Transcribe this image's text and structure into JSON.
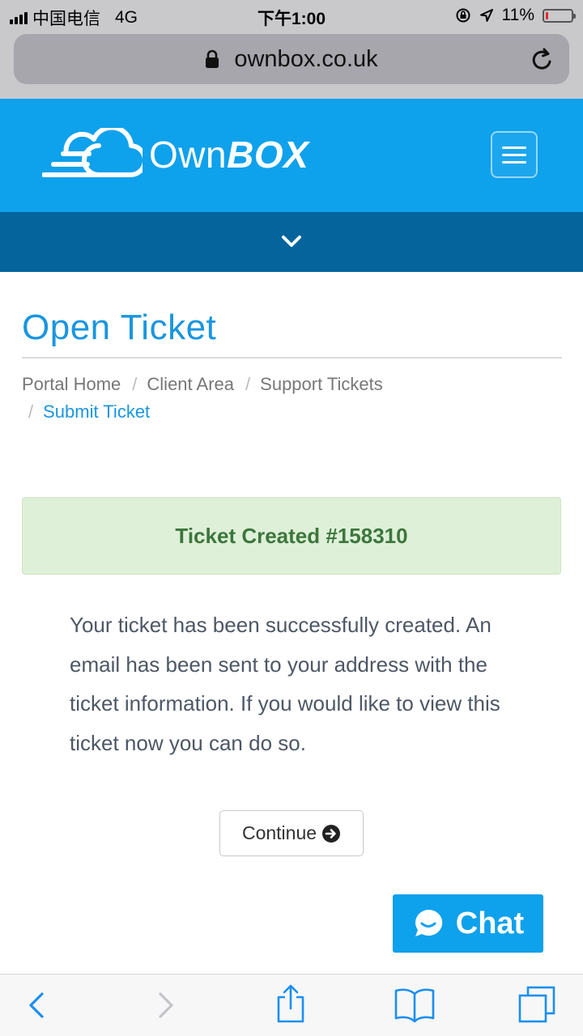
{
  "status_bar": {
    "carrier": "中国电信",
    "network": "4G",
    "time": "下午1:00",
    "battery_text": "11%",
    "battery_level": 0.11,
    "battery_color": "#e32b2b"
  },
  "browser": {
    "url": "ownbox.co.uk",
    "icons": {
      "lock": "lock-icon",
      "reload": "reload-icon"
    }
  },
  "header": {
    "brand_light": "Own",
    "brand_bold": "BOX",
    "background": "#0ea1ec",
    "subnav_background": "#05649c",
    "icons": {
      "logo": "cloud-logo-icon",
      "menu": "hamburger-menu-icon",
      "expand": "chevron-down-icon"
    }
  },
  "page": {
    "title": "Open Ticket",
    "breadcrumb": [
      {
        "label": "Portal Home"
      },
      {
        "label": "Client Area"
      },
      {
        "label": "Support Tickets"
      },
      {
        "label": "Submit Ticket"
      }
    ],
    "breadcrumb_separator": "/"
  },
  "alert": {
    "text": "Ticket Created #158310",
    "background": "#dff0d8",
    "color": "#3c763d"
  },
  "message": "Your ticket has been successfully created. An email has been sent to your address with the ticket information. If you would like to view this ticket now you can do so.",
  "continue_button": {
    "label": "Continue",
    "icon": "arrow-circle-right-icon"
  },
  "chat_button": {
    "label": "Chat",
    "icon": "chat-bubble-icon",
    "background": "#0ea1ec"
  },
  "toolbar": {
    "icons": [
      "back-icon",
      "forward-icon",
      "share-icon",
      "bookmarks-icon",
      "tabs-icon"
    ],
    "accent": "#1a8ff0"
  }
}
